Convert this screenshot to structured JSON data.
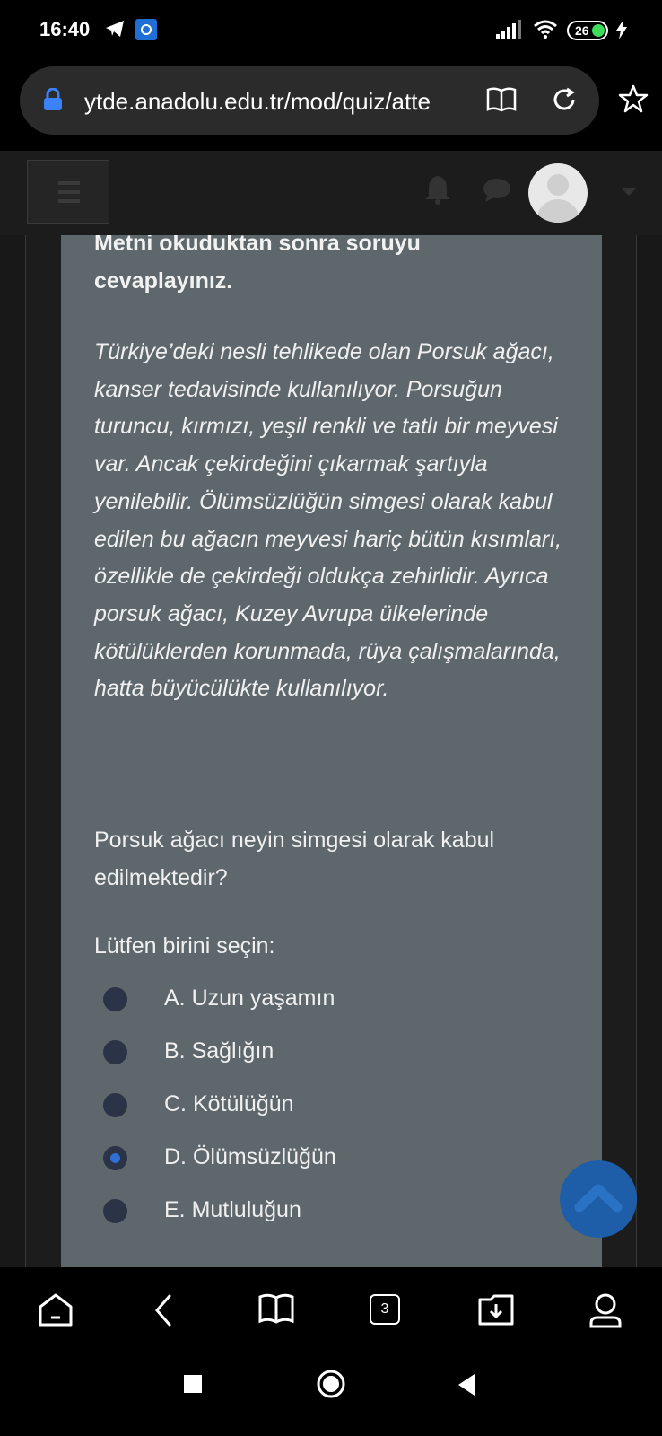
{
  "status_bar": {
    "time": "16:40",
    "battery": "26",
    "icons": [
      "telegram-icon",
      "app-notification-icon",
      "signal-icon",
      "wifi-icon",
      "battery-icon",
      "charging-icon"
    ]
  },
  "browser": {
    "url": "ytde.anadolu.edu.tr/mod/quiz/atte",
    "icons": [
      "lock-icon",
      "reader-mode-icon",
      "reload-icon",
      "bookmark-star-icon"
    ],
    "tabs_count": "3",
    "toolbar_icons": [
      "home-icon",
      "back-icon",
      "bookmarks-icon",
      "tabs-icon",
      "downloads-icon",
      "profile-icon"
    ]
  },
  "navbar": {
    "icons": [
      "menu-icon",
      "bell-icon",
      "chat-icon",
      "avatar",
      "caret-down-icon"
    ]
  },
  "question": {
    "instruction": "Metni okuduktan sonra soruyu cevaplayınız.",
    "passage": "Türkiye’deki nesli tehlikede olan Porsuk ağacı, kanser tedavisinde kullanılıyor. Porsuğun turuncu, kırmızı, yeşil renkli ve tatlı bir meyvesi var. Ancak çekirdeğini çıkarmak şartıyla yenilebilir. Ölümsüzlüğün simgesi olarak kabul edilen bu ağacın meyvesi hariç bütün kısımları, özellikle de çekirdeği oldukça zehirlidir. Ayrıca porsuk ağacı, Kuzey Avrupa ülkelerinde kötülüklerden korunmada, rüya çalışmalarında, hatta büyücülükte kullanılıyor.",
    "text": "Porsuk ağacı neyin simgesi olarak kabul edilmektedir?",
    "prompt": "Lütfen birini seçin:",
    "options": [
      {
        "label": "A. Uzun yaşamın",
        "selected": false
      },
      {
        "label": "B. Sağlığın",
        "selected": false
      },
      {
        "label": "C. Kötülüğün",
        "selected": false
      },
      {
        "label": "D. Ölümsüzlüğün",
        "selected": true
      },
      {
        "label": "E. Mutluluğun",
        "selected": false
      }
    ]
  },
  "colors": {
    "card_bg": "#5e686c",
    "navbar_bg": "#1c1c1c",
    "radio_selected": "#2f6fd6",
    "scroll_button": "#1e5ea8"
  }
}
